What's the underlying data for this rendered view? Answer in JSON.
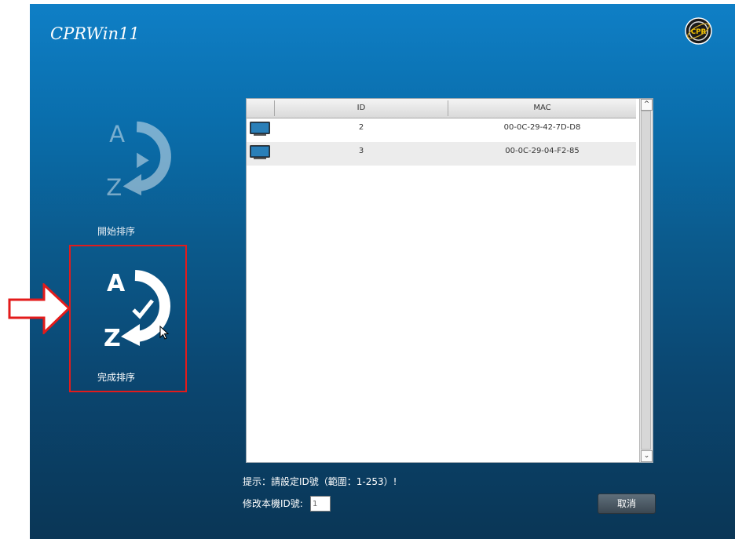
{
  "app": {
    "title": "CPRWin11",
    "logo_text": "CPR"
  },
  "sidebar": {
    "start_sort_label": "開始排序",
    "done_sort_label": "完成排序"
  },
  "table": {
    "columns": [
      "ID",
      "MAC"
    ],
    "rows": [
      {
        "id": "2",
        "mac": "00-0C-29-42-7D-D8"
      },
      {
        "id": "3",
        "mac": "00-0C-29-04-F2-85"
      }
    ]
  },
  "footer": {
    "hint": "提示：請設定ID號（範圍：1-253）!",
    "id_label": "修改本機ID號:",
    "id_value": "1",
    "cancel_label": "取消"
  },
  "colors": {
    "highlight": "#e31b1b",
    "accent": "#0f7fc6"
  }
}
